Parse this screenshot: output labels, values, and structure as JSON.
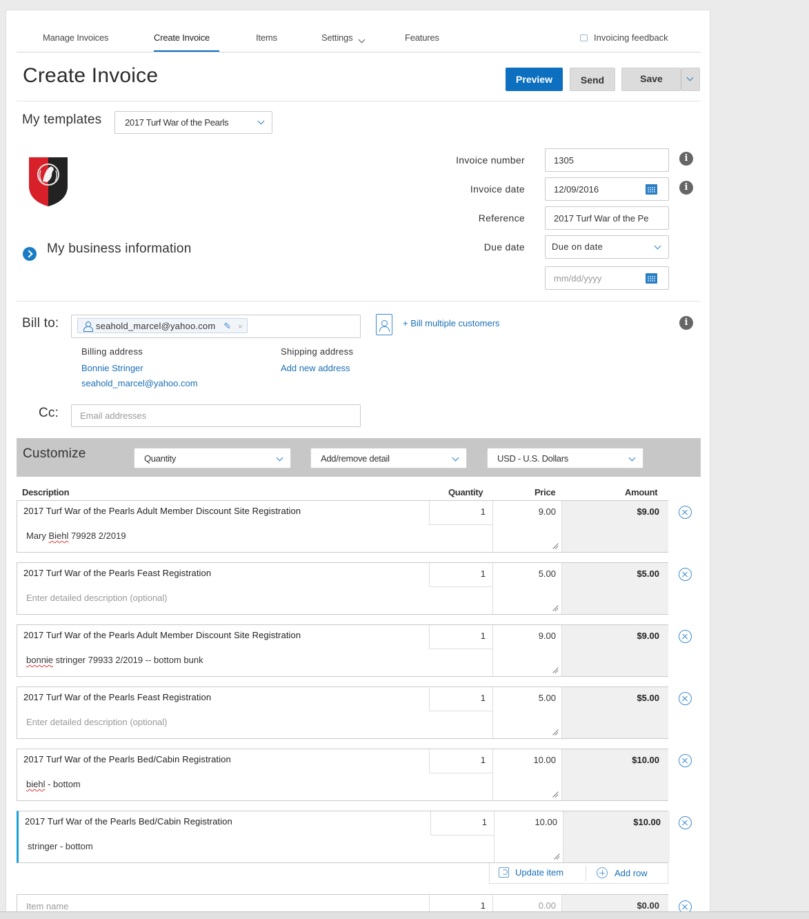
{
  "nav": {
    "tabs": [
      {
        "label": "Manage Invoices"
      },
      {
        "label": "Create Invoice"
      },
      {
        "label": "Items"
      },
      {
        "label": "Settings"
      },
      {
        "label": "Features"
      }
    ],
    "active_tab": "Create Invoice",
    "feedback_label": "Invoicing feedback"
  },
  "header": {
    "title": "Create Invoice",
    "preview_label": "Preview",
    "send_label": "Send",
    "save_label": "Save"
  },
  "templates": {
    "label": "My templates",
    "selected": "2017 Turf War of the Pearls"
  },
  "invoice_fields": {
    "number_label": "Invoice number",
    "number_value": "1305",
    "date_label": "Invoice date",
    "date_value": "12/09/2016",
    "reference_label": "Reference",
    "reference_value": "2017 Turf War of the Pe",
    "due_label": "Due date",
    "due_value": "Due on date",
    "due_date_placeholder": "mm/dd/yyyy"
  },
  "business": {
    "label": "My business information"
  },
  "bill_to": {
    "label": "Bill to:",
    "chip_email": "seahold_marcel@yahoo.com",
    "chip_remove": "×",
    "bill_multiple_label": "+ Bill multiple customers",
    "billing_address_label": "Billing address",
    "billing_name": "Bonnie Stringer",
    "billing_email": "seahold_marcel@yahoo.com",
    "shipping_address_label": "Shipping address",
    "add_address_label": "Add new address"
  },
  "cc": {
    "label": "Cc:",
    "placeholder": "Email addresses"
  },
  "customize": {
    "label": "Customize",
    "quantity_select": "Quantity",
    "detail_select": "Add/remove detail",
    "currency_select": "USD - U.S. Dollars"
  },
  "table": {
    "headers": {
      "description": "Description",
      "quantity": "Quantity",
      "price": "Price",
      "amount": "Amount"
    },
    "items": [
      {
        "description": "2017 Turf War of the Pearls Adult Member Discount Site Registration",
        "detail_pre": "Mary ",
        "detail_mark": "Biehl",
        "detail_post": " 79928  2/2019",
        "detail_placeholder": false,
        "quantity": "1",
        "price": "9.00",
        "amount": "$9.00"
      },
      {
        "description": "2017 Turf War of the Pearls Feast Registration",
        "detail_pre": "Enter detailed description (optional)",
        "detail_mark": "",
        "detail_post": "",
        "detail_placeholder": true,
        "quantity": "1",
        "price": "5.00",
        "amount": "$5.00"
      },
      {
        "description": "2017 Turf War of the Pearls Adult Member Discount Site Registration",
        "detail_pre": "",
        "detail_mark": "bonnie",
        "detail_post": " stringer 79933 2/2019 -- bottom bunk",
        "detail_placeholder": false,
        "quantity": "1",
        "price": "9.00",
        "amount": "$9.00"
      },
      {
        "description": "2017 Turf War of the Pearls Feast Registration",
        "detail_pre": "Enter detailed description (optional)",
        "detail_mark": "",
        "detail_post": "",
        "detail_placeholder": true,
        "quantity": "1",
        "price": "5.00",
        "amount": "$5.00"
      },
      {
        "description": "2017 Turf War of the Pearls Bed/Cabin Registration",
        "detail_pre": "",
        "detail_mark": "biehl",
        "detail_post": " - bottom",
        "detail_placeholder": false,
        "quantity": "1",
        "price": "10.00",
        "amount": "$10.00"
      },
      {
        "description": "2017 Turf War of the Pearls Bed/Cabin Registration",
        "detail_pre": "stringer - bottom",
        "detail_mark": "",
        "detail_post": "",
        "detail_placeholder": false,
        "quantity": "1",
        "price": "10.00",
        "amount": "$10.00"
      }
    ],
    "update_item_label": "Update item",
    "add_row_label": "Add row",
    "new_row": {
      "placeholder": "Item name",
      "quantity": "1",
      "price": "0.00",
      "amount": "$0.00"
    }
  },
  "colors": {
    "primary": "#0c6fbf",
    "link": "#1a6fb7",
    "active_row_accent": "#1aa1d8",
    "customize_bar": "#c7c7c7"
  }
}
